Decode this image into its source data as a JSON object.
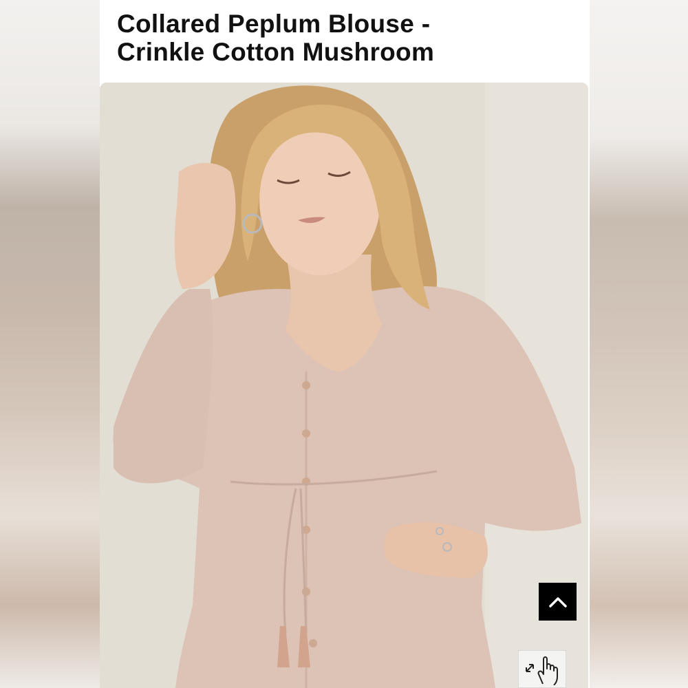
{
  "product": {
    "title_line1": "Collared Peplum Blouse -",
    "title_line2": "Crinkle Cotton Mushroom",
    "image_alt": "Model wearing Collared Peplum Blouse in Crinkle Cotton Mushroom"
  },
  "controls": {
    "back_to_top_icon": "chevron-up-icon",
    "zoom_icon": "pinch-zoom-hand-icon"
  },
  "colors": {
    "accent": "#000000",
    "background": "#ffffff",
    "garment": "#dcc3b6"
  }
}
